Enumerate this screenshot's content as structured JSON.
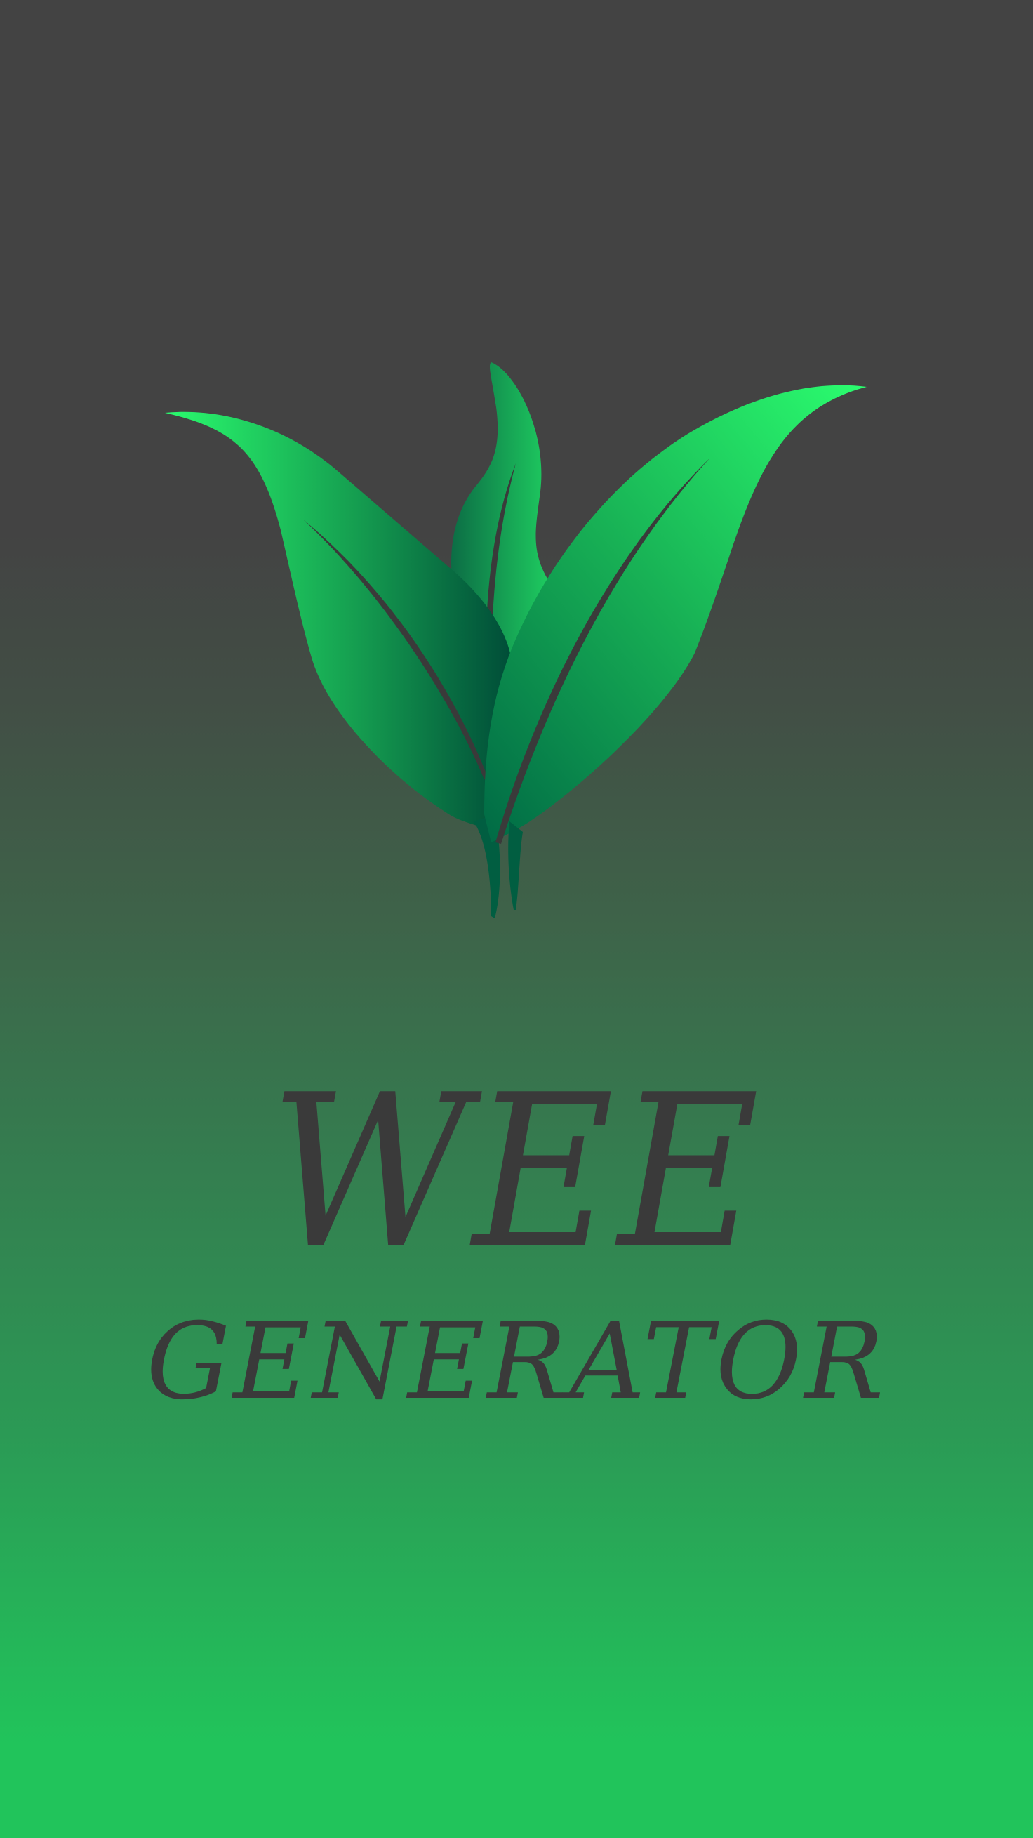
{
  "app": {
    "title_line1": "WEE",
    "title_line2": "GENERATOR"
  },
  "logo": {
    "icon": "leaf-sprout-icon"
  },
  "colors": {
    "background_top": "#434343",
    "background_bottom": "#21c45b",
    "leaf_light": "#29fd6f",
    "leaf_mid": "#16a84f",
    "leaf_dark": "#00503a",
    "text": "#3a3a3a"
  }
}
